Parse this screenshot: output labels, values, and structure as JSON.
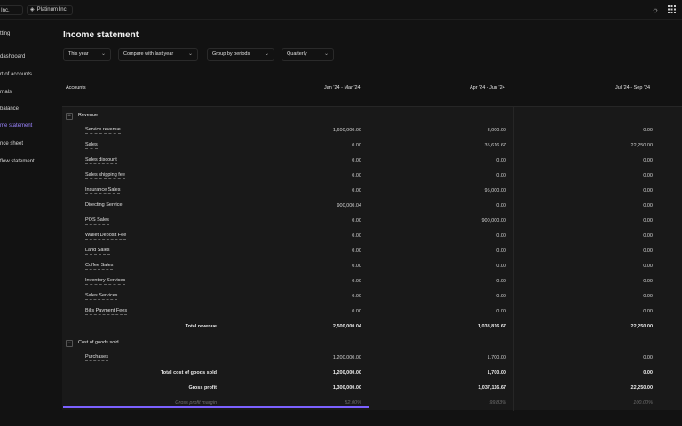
{
  "topbar": {
    "crumb1": "rum Inc.",
    "crumb2": "Platinum Inc.",
    "crumb2_logo_icon": "diamond-logo-icon",
    "theme_icon": "sun-icon",
    "apps_icon": "grid-icon"
  },
  "sidebar": {
    "items": [
      {
        "label": "tting",
        "active": false
      },
      {
        "label": "dashboard",
        "active": false
      },
      {
        "label": "rt of accounts",
        "active": false
      },
      {
        "label": "rnals",
        "active": false
      },
      {
        "label": "balance",
        "active": false
      },
      {
        "label": "me statement",
        "active": true
      },
      {
        "label": "nce sheet",
        "active": false
      },
      {
        "label": "flow statement",
        "active": false
      }
    ]
  },
  "page": {
    "title": "Income statement"
  },
  "filters": [
    {
      "label": "This year"
    },
    {
      "label": "Compare with last year"
    },
    {
      "label": "Group by periods"
    },
    {
      "label": "Quarterly"
    }
  ],
  "table": {
    "headers": {
      "accounts": "Accounts",
      "p1": "Jan '24 - Mar '24",
      "p2": "Apr '24 - Jun '24",
      "p3": "Jul '24 - Sep '24"
    },
    "revenue": {
      "label": "Revenue",
      "toggle": "−",
      "rows": [
        {
          "name": "Service revenue",
          "v": [
            "1,600,000.00",
            "8,000.00",
            "0.00"
          ]
        },
        {
          "name": "Sales",
          "v": [
            "0.00",
            "35,616.67",
            "22,250.00"
          ]
        },
        {
          "name": "Sales discount",
          "v": [
            "0.00",
            "0.00",
            "0.00"
          ]
        },
        {
          "name": "Sales shipping fee",
          "v": [
            "0.00",
            "0.00",
            "0.00"
          ]
        },
        {
          "name": "Insurance Sales",
          "v": [
            "0.00",
            "95,000.00",
            "0.00"
          ]
        },
        {
          "name": "Directing Service",
          "v": [
            "900,000.04",
            "0.00",
            "0.00"
          ]
        },
        {
          "name": "POS Sales",
          "v": [
            "0.00",
            "900,000.00",
            "0.00"
          ]
        },
        {
          "name": "Wallet Deposit Fee",
          "v": [
            "0.00",
            "0.00",
            "0.00"
          ]
        },
        {
          "name": "Land Sales",
          "v": [
            "0.00",
            "0.00",
            "0.00"
          ]
        },
        {
          "name": "Coffee Sales",
          "v": [
            "0.00",
            "0.00",
            "0.00"
          ]
        },
        {
          "name": "Inventory Services",
          "v": [
            "0.00",
            "0.00",
            "0.00"
          ]
        },
        {
          "name": "Sales Services",
          "v": [
            "0.00",
            "0.00",
            "0.00"
          ]
        },
        {
          "name": "Bills Payment Fees",
          "v": [
            "0.00",
            "0.00",
            "0.00"
          ]
        }
      ],
      "total": {
        "label": "Total revenue",
        "v": [
          "2,500,000.04",
          "1,038,816.67",
          "22,250.00"
        ]
      }
    },
    "cogs": {
      "label": "Cost of goods sold",
      "toggle": "−",
      "rows": [
        {
          "name": "Purchases",
          "v": [
            "1,200,000.00",
            "1,700.00",
            "0.00"
          ]
        }
      ],
      "total": {
        "label": "Total cost of goods sold",
        "v": [
          "1,200,000.00",
          "1,700.00",
          "0.00"
        ]
      }
    },
    "gross_profit": {
      "label": "Gross profit",
      "v": [
        "1,300,000.00",
        "1,037,116.67",
        "22,250.00"
      ]
    },
    "gross_margin": {
      "label": "Gross profit margin",
      "v": [
        "52.00%",
        "99.83%",
        "100.00%"
      ]
    }
  },
  "colors": {
    "accent": "#7b61ff",
    "background": "#121212",
    "table_bg": "#191919"
  }
}
